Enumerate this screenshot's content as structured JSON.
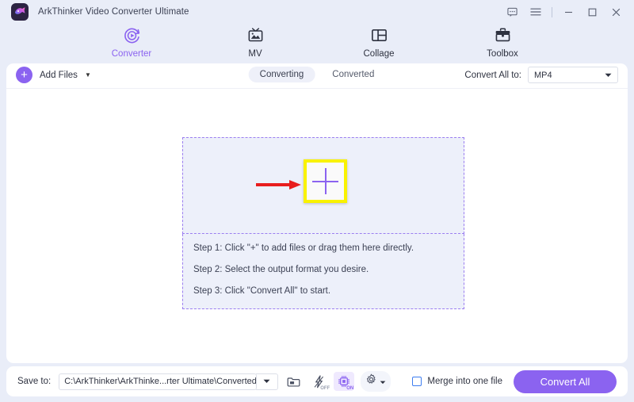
{
  "window": {
    "app_title": "ArkThinker Video Converter Ultimate",
    "app_icon": "app-logo-icon",
    "controls": {
      "feedback": "feedback-icon",
      "menu": "menu-icon",
      "minimize": "minimize-icon",
      "maximize": "maximize-icon",
      "close": "close-icon"
    }
  },
  "nav": {
    "tabs": [
      {
        "label": "Converter",
        "icon": "converter-icon",
        "active": true
      },
      {
        "label": "MV",
        "icon": "mv-icon",
        "active": false
      },
      {
        "label": "Collage",
        "icon": "collage-icon",
        "active": false
      },
      {
        "label": "Toolbox",
        "icon": "toolbox-icon",
        "active": false
      }
    ]
  },
  "toolbar": {
    "add_files_label": "Add Files",
    "segments": [
      {
        "label": "Converting",
        "active": true
      },
      {
        "label": "Converted",
        "active": false
      }
    ],
    "convert_all_to_label": "Convert All to:",
    "format_value": "MP4"
  },
  "dropzone": {
    "plus_symbol": "+",
    "steps": [
      "Step 1: Click \"+\" to add files or drag them here directly.",
      "Step 2: Select the output format you desire.",
      "Step 3: Click \"Convert All\" to start."
    ]
  },
  "bottom": {
    "save_to_label": "Save to:",
    "save_path": "C:\\ArkThinker\\ArkThinke...rter Ultimate\\Converted",
    "folder_icon": "folder-icon",
    "hw_accel_icon": "lightning-bolt-icon",
    "hw_accel_state": "OFF",
    "gpu_icon": "gpu-chip-icon",
    "gpu_state": "ON",
    "settings_icon": "gear-icon",
    "merge_label": "Merge into one file",
    "merge_checked": false,
    "convert_all_button": "Convert All"
  },
  "colors": {
    "accent_purple": "#8b63f0",
    "window_bg": "#e9edf8",
    "panel_bg": "#ffffff",
    "dropzone_bg": "#edf0fa",
    "dashed_border": "#9b7ef0",
    "highlight_yellow": "#f9f200",
    "arrow_red": "#e81d1d",
    "checkbox_blue": "#3d7df0"
  }
}
